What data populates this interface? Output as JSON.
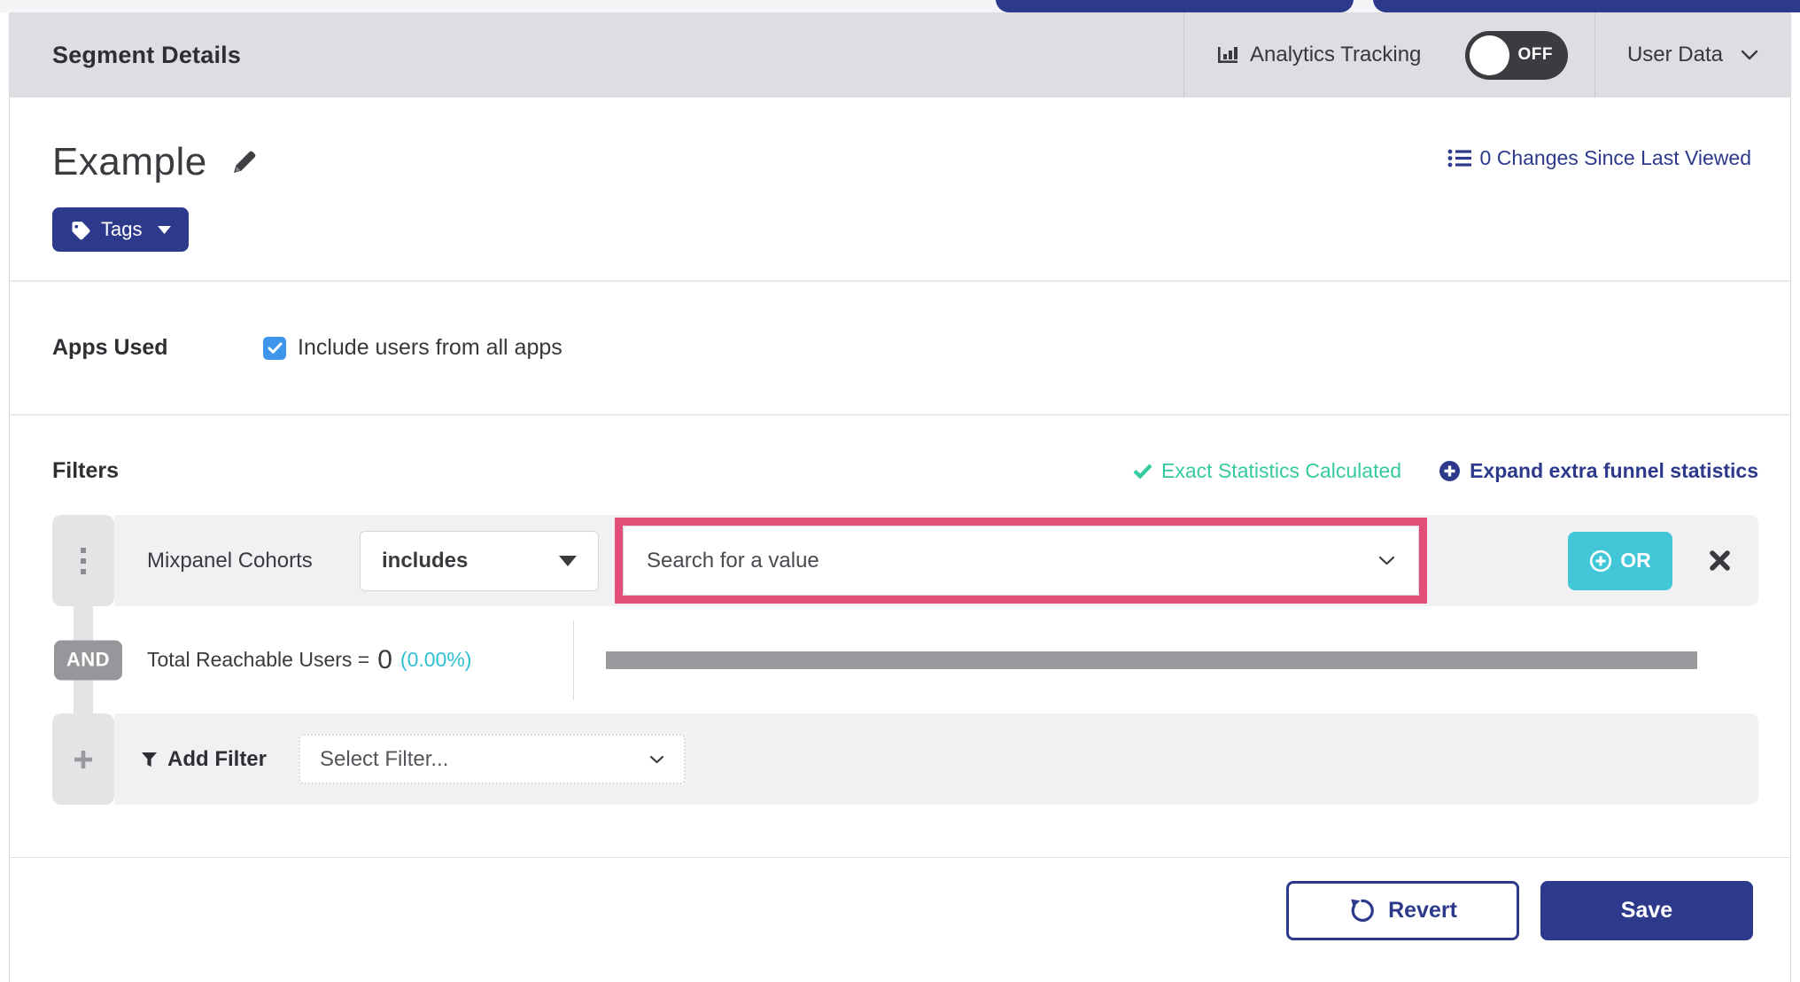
{
  "colors": {
    "navy_accent": "#2d3a8c",
    "teal_success": "#36caa0",
    "cyan_or_button": "#41c7d8",
    "cyan_percent": "#2fc0d3",
    "highlight_pink": "#e14e78",
    "checkbox_blue": "#3e96ec",
    "bar_gray": "#9b9a9e",
    "and_badge_gray": "#96969b",
    "toggle_bg": "#3b3b40",
    "header_bar_gray": "#dedde1"
  },
  "header": {
    "title": "Segment Details",
    "analytics": {
      "icon": "bar-chart-icon",
      "label": "Analytics Tracking",
      "toggle_state": "OFF",
      "toggle_on": false
    },
    "user_data": {
      "label": "User Data",
      "icon": "chevron-down-icon"
    }
  },
  "segment": {
    "name": "Example",
    "edit_icon": "pencil-icon",
    "tags_button": {
      "icon": "tag-icon",
      "label": "Tags",
      "caret_icon": "caret-down-icon"
    },
    "changes_link": {
      "icon": "list-icon",
      "label": "0 Changes Since Last Viewed"
    }
  },
  "apps_used": {
    "label": "Apps Used",
    "checkbox": {
      "checked": true,
      "label": "Include users from all apps"
    }
  },
  "filters": {
    "title": "Filters",
    "exact_stats": {
      "icon": "check-icon",
      "label": "Exact Statistics Calculated"
    },
    "expand_link": {
      "icon": "plus-circle-icon",
      "label": "Expand extra funnel statistics"
    },
    "filter_row": {
      "drag_icon": "drag-handle-icon",
      "name": "Mixpanel Cohorts",
      "operator": "includes",
      "value_placeholder": "Search for a value",
      "or_button": {
        "icon": "plus-circle-icon",
        "label": "OR"
      },
      "remove_icon": "close-icon"
    },
    "and_row": {
      "badge": "AND",
      "label": "Total Reachable Users =",
      "value": "0",
      "percent": "(0.00%)",
      "bar_fill_fraction": 0
    },
    "add_row": {
      "add_icon": "plus-icon",
      "funnel_icon": "funnel-icon",
      "label": "Add Filter",
      "placeholder": "Select Filter..."
    }
  },
  "footer": {
    "revert_button": {
      "icon": "revert-icon",
      "label": "Revert"
    },
    "save_button": {
      "label": "Save"
    }
  }
}
